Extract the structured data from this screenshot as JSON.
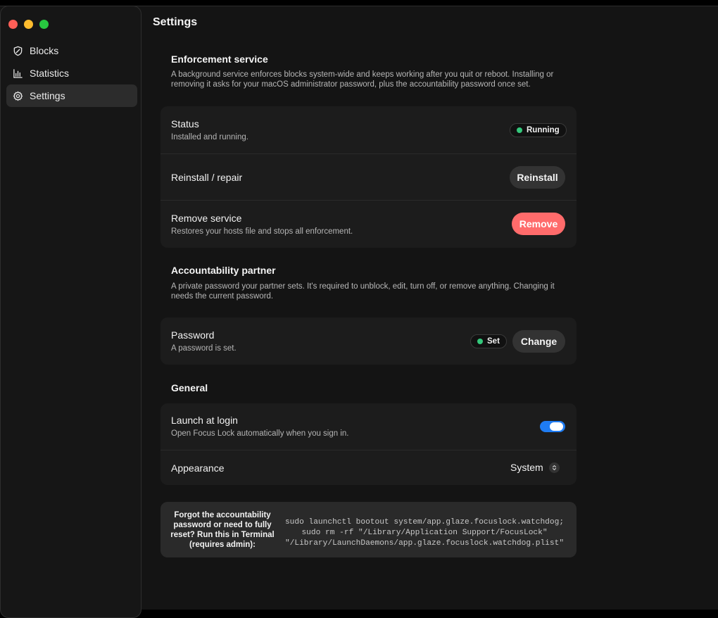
{
  "window": {
    "controls": [
      "close",
      "minimize",
      "zoom"
    ]
  },
  "sidebar": {
    "items": [
      {
        "label": "Blocks",
        "icon": "shield-icon",
        "active": false
      },
      {
        "label": "Statistics",
        "icon": "bar-chart-icon",
        "active": false
      },
      {
        "label": "Settings",
        "icon": "gear-icon",
        "active": true
      }
    ]
  },
  "page": {
    "title": "Settings"
  },
  "enforcement": {
    "heading": "Enforcement service",
    "description": "A background service enforces blocks system-wide and keeps working after you quit or reboot. Installing or removing it asks for your macOS administrator password, plus the accountability password once set.",
    "status": {
      "label": "Status",
      "sub": "Installed and running.",
      "badge": "Running",
      "badge_color": "#34c77b"
    },
    "reinstall": {
      "label": "Reinstall / repair",
      "button": "Reinstall"
    },
    "remove": {
      "label": "Remove service",
      "sub": "Restores your hosts file and stops all enforcement.",
      "button": "Remove",
      "button_color": "#ff6b6b"
    }
  },
  "accountability": {
    "heading": "Accountability partner",
    "description": "A private password your partner sets. It's required to unblock, edit, turn off, or remove anything. Changing it needs the current password.",
    "password": {
      "label": "Password",
      "sub": "A password is set.",
      "badge": "Set",
      "button": "Change"
    }
  },
  "general": {
    "heading": "General",
    "launch": {
      "label": "Launch at login",
      "sub": "Open Focus Lock automatically when you sign in.",
      "enabled": true,
      "toggle_color": "#1f7cf2"
    },
    "appearance": {
      "label": "Appearance",
      "value": "System"
    }
  },
  "reset": {
    "label": "Forgot the accountability password or need to fully reset? Run this in Terminal (requires admin):",
    "command": "sudo launchctl bootout system/app.glaze.focuslock.watchdog;\nsudo rm -rf \"/Library/Application Support/FocusLock\"\n\"/Library/LaunchDaemons/app.glaze.focuslock.watchdog.plist\""
  }
}
